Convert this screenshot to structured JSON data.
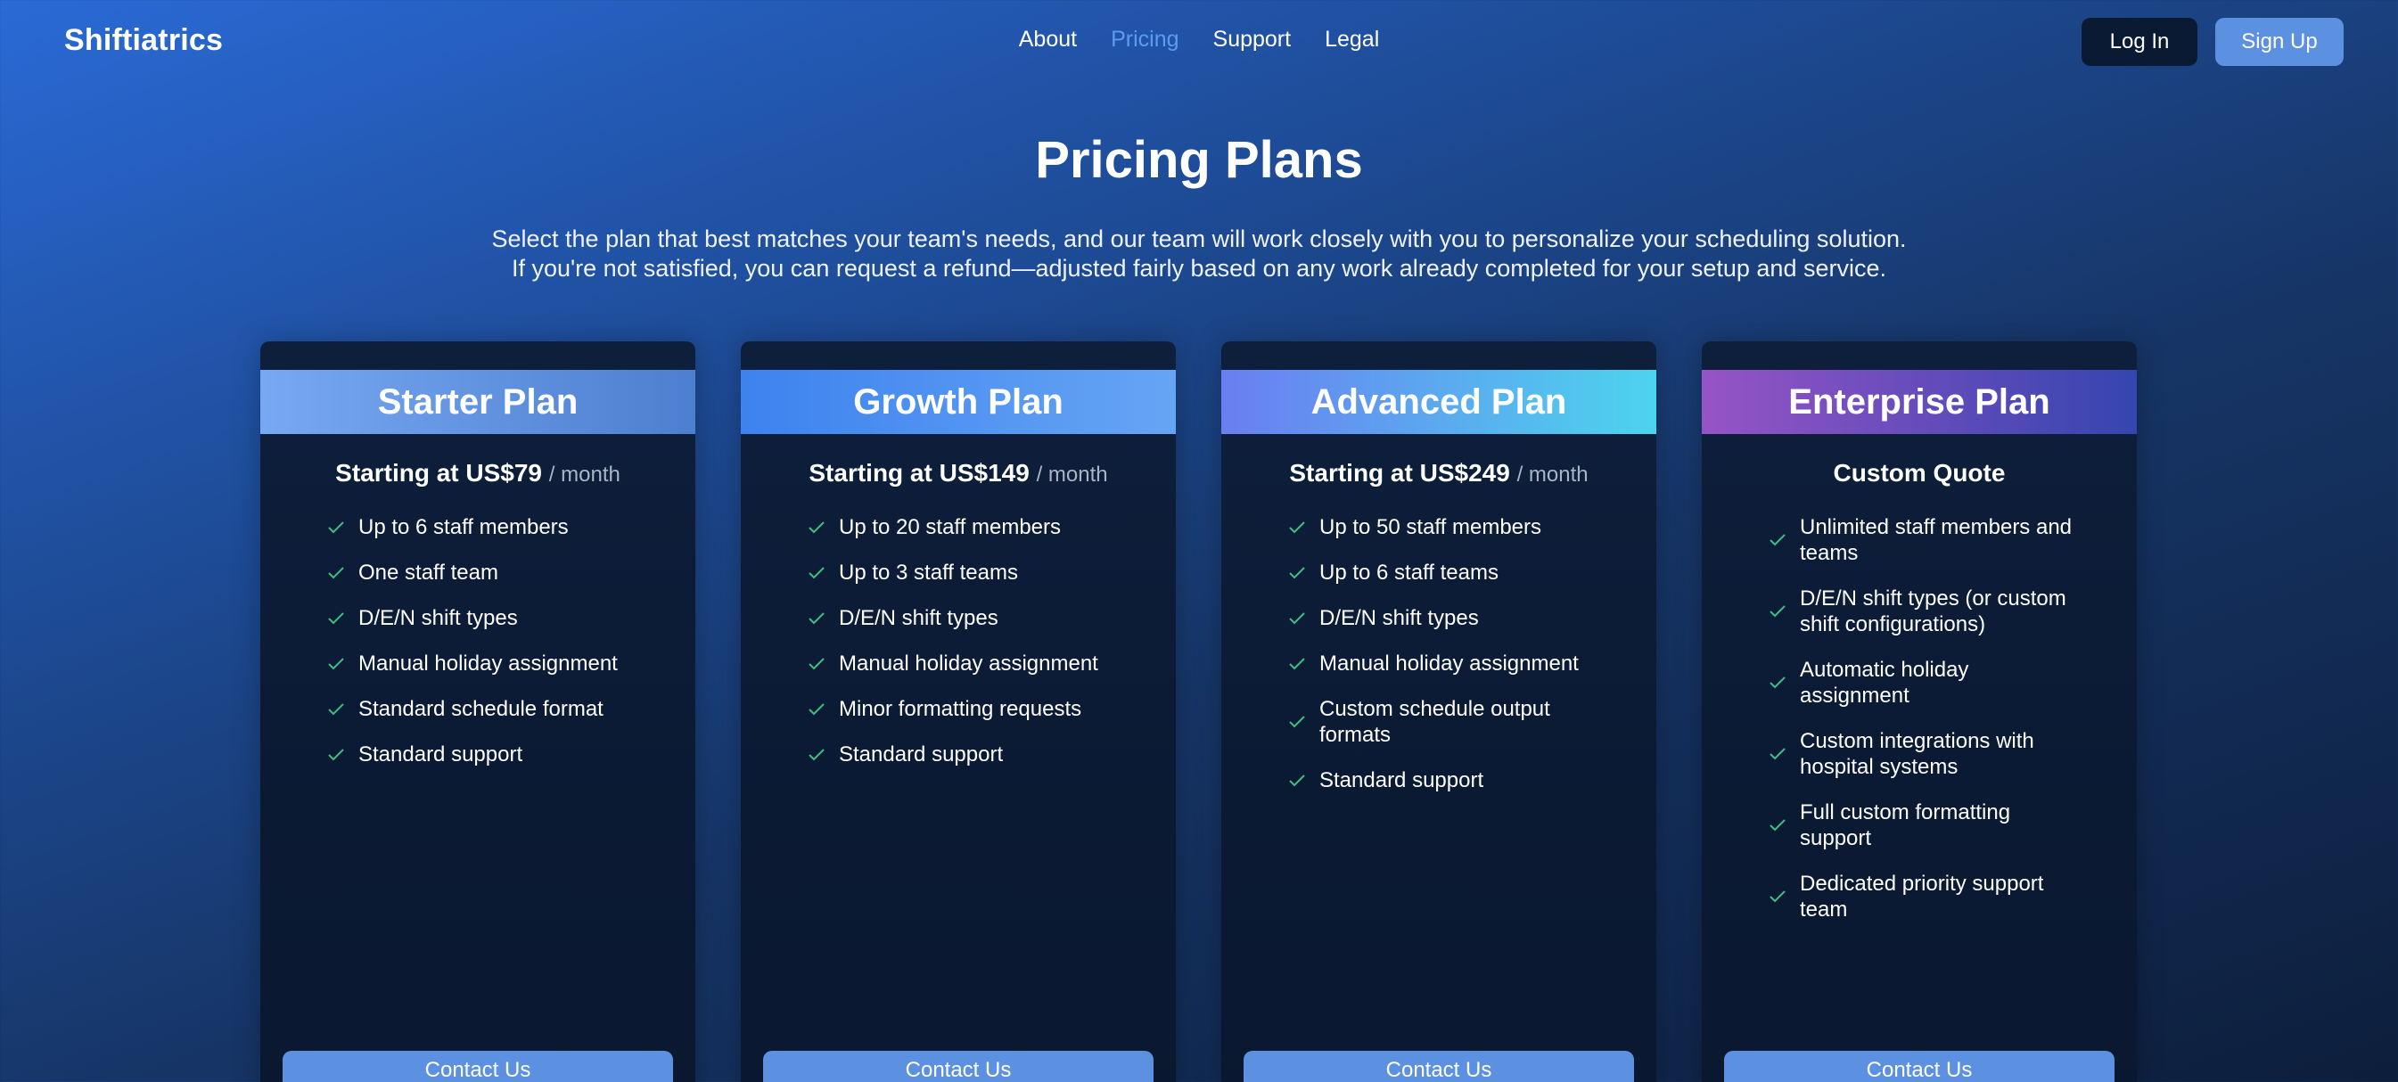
{
  "nav": {
    "brand": "Shiftiatrics",
    "links": [
      "About",
      "Pricing",
      "Support",
      "Legal"
    ],
    "active_link": "Pricing",
    "login_label": "Log In",
    "signup_label": "Sign Up"
  },
  "hero": {
    "title": "Pricing Plans",
    "subtitle_line1": "Select the plan that best matches your team's needs, and our team will work closely with you to personalize your scheduling solution.",
    "subtitle_line2": "If you're not satisfied, you can request a refund—adjusted fairly based on any work already completed for your setup and service."
  },
  "plans": [
    {
      "name": "Starter Plan",
      "price": "Starting at US$79",
      "per": "/ month",
      "features": [
        "Up to 6 staff members",
        "One staff team",
        "D/E/N shift types",
        "Manual holiday assignment",
        "Standard schedule format",
        "Standard support"
      ],
      "cta": "Contact Us"
    },
    {
      "name": "Growth Plan",
      "price": "Starting at US$149",
      "per": "/ month",
      "features": [
        "Up to 20 staff members",
        "Up to 3 staff teams",
        "D/E/N shift types",
        "Manual holiday assignment",
        "Minor formatting requests",
        "Standard support"
      ],
      "cta": "Contact Us"
    },
    {
      "name": "Advanced Plan",
      "price": "Starting at US$249",
      "per": "/ month",
      "features": [
        "Up to 50 staff members",
        "Up to 6 staff teams",
        "D/E/N shift types",
        "Manual holiday assignment",
        "Custom schedule output formats",
        "Standard support"
      ],
      "cta": "Contact Us"
    },
    {
      "name": "Enterprise Plan",
      "price": "Custom Quote",
      "per": "",
      "features": [
        "Unlimited staff members and teams",
        "D/E/N shift types (or custom shift configurations)",
        "Automatic holiday assignment",
        "Custom integrations with hospital systems",
        "Full custom formatting support",
        "Dedicated priority support team"
      ],
      "cta": "Contact Us"
    }
  ],
  "colors": {
    "accent": "#5b91e0",
    "active_link": "#5b9cf0",
    "check": "#3fbf7f",
    "card_bg": "#0b1a33"
  },
  "icons": {
    "feature": "check-icon"
  }
}
